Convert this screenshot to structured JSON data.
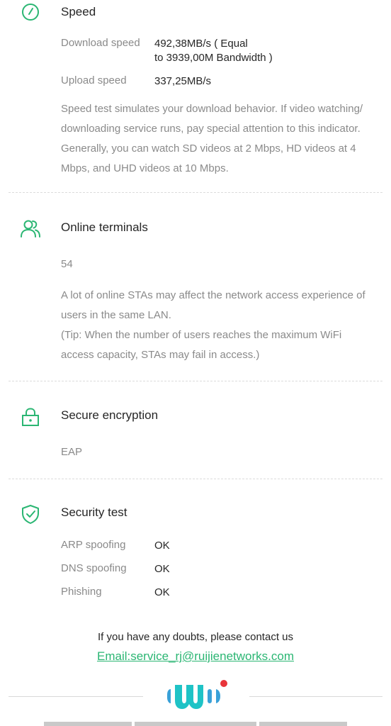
{
  "speed": {
    "title": "Speed",
    "download_label": "Download speed",
    "download_value_line1": "492,38MB/s ( Equal",
    "download_value_line2": "to 3939,00M Bandwidth )",
    "upload_label": "Upload speed",
    "upload_value": "337,25MB/s",
    "desc_lines": [
      "Speed test simulates your download behavior. If video watching/",
      "downloading service runs, pay special attention to this indicator.",
      "Generally, you can watch SD videos at 2 Mbps, HD videos at 4",
      "Mbps, and UHD videos at 10 Mbps."
    ],
    "icon": "speedometer-icon"
  },
  "terminals": {
    "title": "Online terminals",
    "count": "54",
    "desc_lines": [
      "A lot of online STAs may affect the network access experience of",
      "users in the same LAN.",
      "(Tip: When the number of users reaches the maximum WiFi",
      "access capacity, STAs may fail in access.)"
    ],
    "icon": "users-icon"
  },
  "encryption": {
    "title": "Secure encryption",
    "value": "EAP",
    "icon": "lock-icon"
  },
  "security": {
    "title": "Security test",
    "rows": [
      {
        "label": "ARP spoofing",
        "value": "OK"
      },
      {
        "label": "DNS spoofing",
        "value": "OK"
      },
      {
        "label": "Phishing",
        "value": "OK"
      }
    ],
    "icon": "shield-check-icon"
  },
  "footer": {
    "contact_text": "If you have any doubts, please contact us",
    "email": "Email:service_rj@ruijienetworks.com"
  },
  "colors": {
    "accent": "#2bb673",
    "logo_blue": "#3aa1d8",
    "logo_teal": "#1fc3c6",
    "logo_red": "#e8343a"
  }
}
